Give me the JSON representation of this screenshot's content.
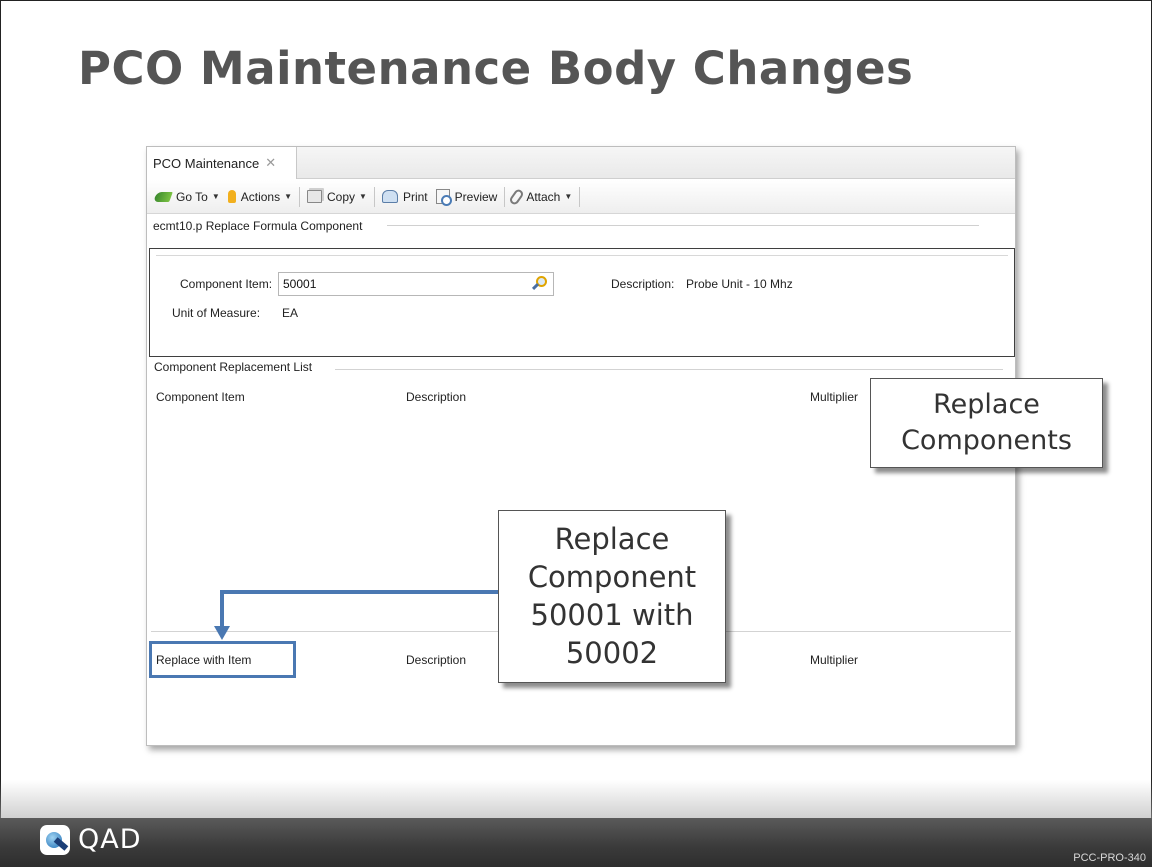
{
  "slide": {
    "title": "PCO Maintenance Body Changes",
    "code": "PCC-PRO-340",
    "logo_text": "QAD"
  },
  "window": {
    "tab_label": "PCO Maintenance",
    "tab_close": "✕",
    "toolbar": {
      "goto": "Go To",
      "actions": "Actions",
      "copy": "Copy",
      "print": "Print",
      "preview": "Preview",
      "attach": "Attach"
    },
    "program_header": "ecmt10.p  Replace Formula Component"
  },
  "form": {
    "component_item_label": "Component Item:",
    "component_item_value": "50001",
    "description_label": "Description:",
    "description_value": "Probe Unit - 10 Mhz",
    "uom_label": "Unit of Measure:",
    "uom_value": "EA"
  },
  "replacement_list": {
    "title": "Component Replacement List",
    "columns": {
      "component_item": "Component Item",
      "description": "Description",
      "multiplier": "Multiplier"
    }
  },
  "replace_with": {
    "label": "Replace with Item",
    "description": "Description",
    "multiplier": "Multiplier"
  },
  "callouts": {
    "replace_components": [
      "Replace",
      "Components"
    ],
    "replace_component": [
      "Replace",
      "Component",
      "50001 with",
      "50002"
    ]
  },
  "colors": {
    "title": "#555555",
    "arrow": "#4a78b2",
    "footer": "#3a3a3a"
  },
  "icons": [
    "goto-icon",
    "bulb-icon",
    "copy-icon",
    "print-icon",
    "preview-icon",
    "paperclip-icon",
    "magnifier-icon",
    "close-icon",
    "qad-logo-icon"
  ]
}
